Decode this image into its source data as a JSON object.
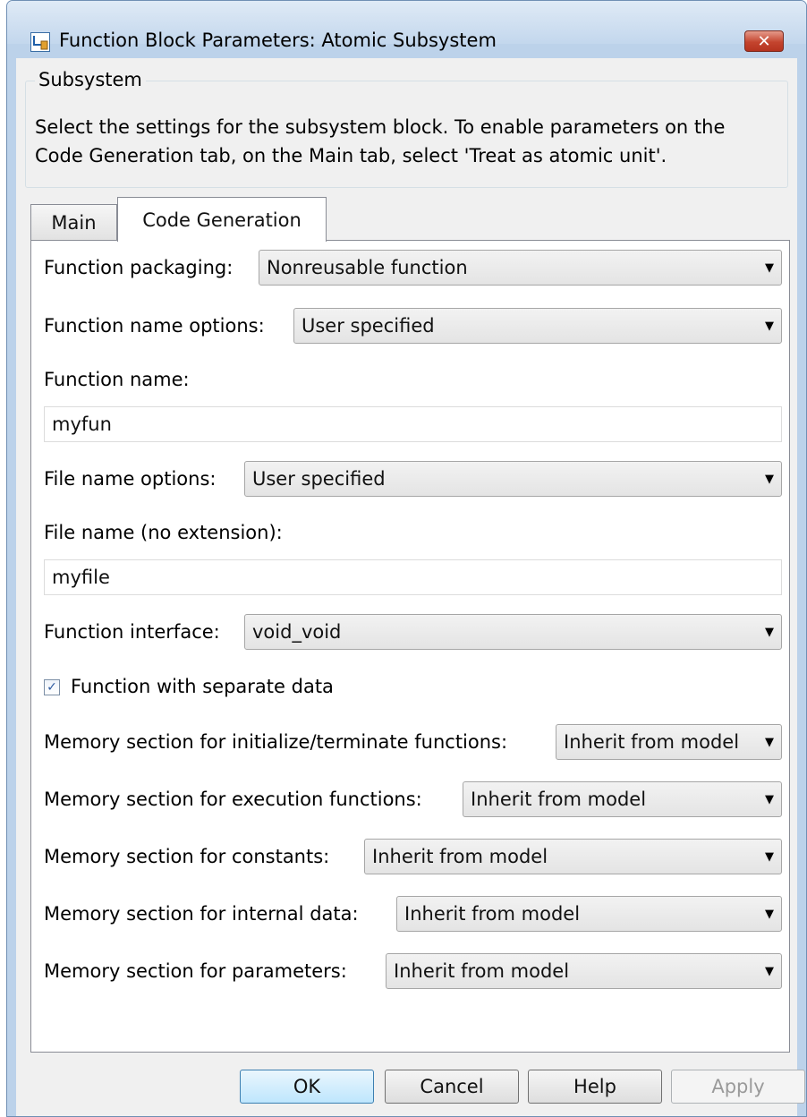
{
  "window": {
    "title": "Function Block Parameters: Atomic Subsystem",
    "close_glyph": "✕"
  },
  "group": {
    "legend": "Subsystem",
    "description": "Select the settings for the subsystem block. To enable parameters on the Code Generation tab, on the Main tab, select 'Treat as atomic unit'."
  },
  "tabs": [
    {
      "label": "Main",
      "active": false
    },
    {
      "label": "Code Generation",
      "active": true
    }
  ],
  "params": {
    "function_packaging": {
      "label": "Function packaging:",
      "value": "Nonreusable function"
    },
    "function_name_options": {
      "label": "Function name options:",
      "value": "User specified"
    },
    "function_name": {
      "label": "Function name:",
      "value": "myfun"
    },
    "file_name_options": {
      "label": "File name options:",
      "value": "User specified"
    },
    "file_name": {
      "label": "File name (no extension):",
      "value": "myfile"
    },
    "function_interface": {
      "label": "Function interface:",
      "value": "void_void"
    },
    "separate_data": {
      "label": "Function with separate data",
      "checked": true,
      "check_glyph": "✓"
    },
    "mem_init_term": {
      "label": "Memory section for initialize/terminate functions:",
      "value": "Inherit from model"
    },
    "mem_execution": {
      "label": "Memory section for execution functions:",
      "value": "Inherit from model"
    },
    "mem_constants": {
      "label": "Memory section for constants:",
      "value": "Inherit from model"
    },
    "mem_internal": {
      "label": "Memory section for internal data:",
      "value": "Inherit from model"
    },
    "mem_parameters": {
      "label": "Memory section for parameters:",
      "value": "Inherit from model"
    }
  },
  "combo_arrow": "▼",
  "buttons": {
    "ok": "OK",
    "cancel": "Cancel",
    "help": "Help",
    "apply": "Apply"
  },
  "colors": {
    "frame": "#bcd2ea",
    "close": "#c4442e",
    "ok_focus": "#3c7fb1"
  }
}
